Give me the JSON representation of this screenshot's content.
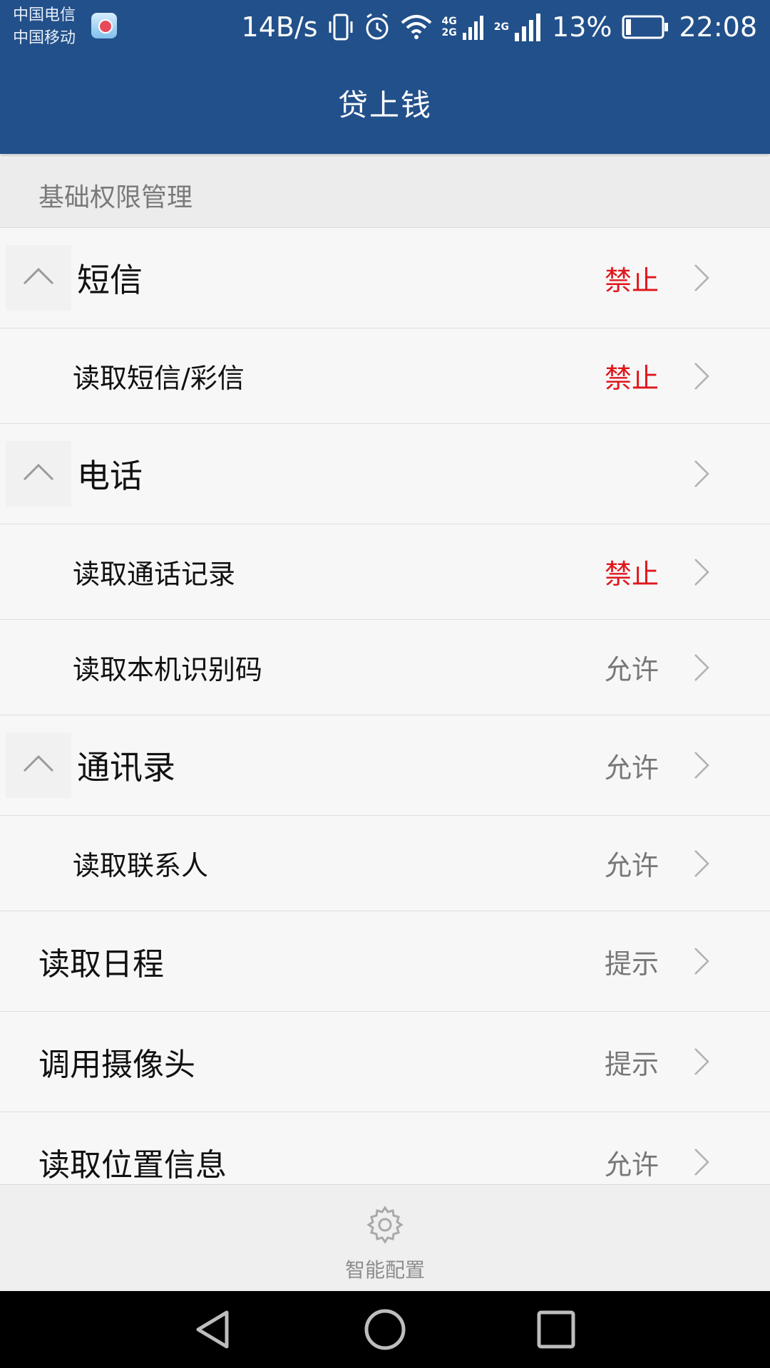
{
  "status_bar": {
    "carrier_1": "中国电信",
    "carrier_2": "中国移动",
    "speed": "14B/s",
    "net_top": "4G",
    "net_bottom": "2G",
    "net_2": "2G",
    "battery": "13%",
    "time": "22:08",
    "icons": [
      "app-notification-icon",
      "vibrate-icon",
      "alarm-icon",
      "wifi-icon",
      "signal-icon",
      "battery-icon"
    ]
  },
  "app_bar": {
    "title": "贷上钱",
    "background": "#22508a"
  },
  "section": {
    "header": "基础权限管理"
  },
  "permissions": [
    {
      "type": "group",
      "label": "短信",
      "status": "禁止",
      "status_kind": "deny",
      "icon": "chevron-up-icon"
    },
    {
      "type": "child",
      "label": "读取短信/彩信",
      "status": "禁止",
      "status_kind": "deny"
    },
    {
      "type": "group",
      "label": "电话",
      "status": "",
      "status_kind": "other",
      "icon": "chevron-up-icon"
    },
    {
      "type": "child",
      "label": "读取通话记录",
      "status": "禁止",
      "status_kind": "deny"
    },
    {
      "type": "child",
      "label": "读取本机识别码",
      "status": "允许",
      "status_kind": "other"
    },
    {
      "type": "group",
      "label": "通讯录",
      "status": "允许",
      "status_kind": "other",
      "icon": "chevron-up-icon"
    },
    {
      "type": "child",
      "label": "读取联系人",
      "status": "允许",
      "status_kind": "other"
    },
    {
      "type": "single",
      "label": "读取日程",
      "status": "提示",
      "status_kind": "other"
    },
    {
      "type": "single",
      "label": "调用摄像头",
      "status": "提示",
      "status_kind": "other"
    },
    {
      "type": "single",
      "label": "读取位置信息",
      "status": "允许",
      "status_kind": "other"
    }
  ],
  "colors": {
    "deny": "#e0161b",
    "neutral": "#777777"
  },
  "bottom_action": {
    "label": "智能配置",
    "icon": "gear-icon"
  },
  "nav_bar": {
    "icons": [
      "back-icon",
      "home-icon",
      "recents-icon"
    ]
  }
}
